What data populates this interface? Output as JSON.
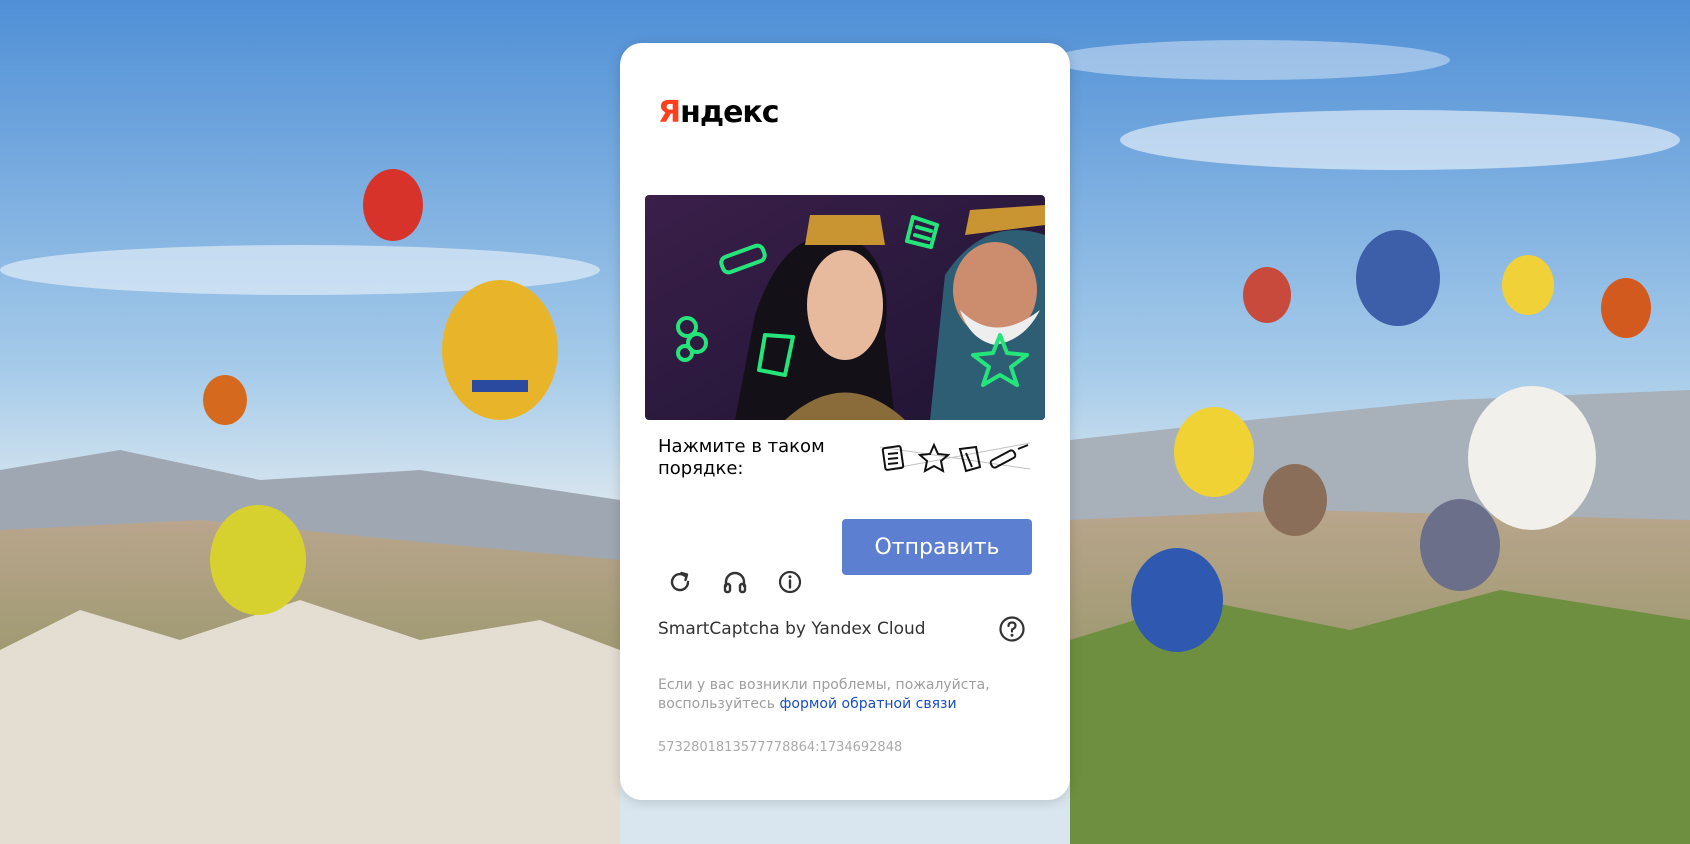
{
  "logo": {
    "first_letter": "Я",
    "rest": "ндекс"
  },
  "captcha": {
    "instruction": "Нажмите в таком порядке:",
    "sequence_icons": [
      "notepad-icon",
      "star-icon",
      "card-icon",
      "pin-icon"
    ]
  },
  "toolbar": {
    "refresh_icon": "refresh-icon",
    "audio_icon": "headphones-icon",
    "info_icon": "info-icon",
    "submit_label": "Отправить"
  },
  "footer": {
    "brand": "SmartCaptcha by Yandex Cloud",
    "help_icon": "question-icon",
    "note_text": "Если у вас возникли проблемы, пожалуйста, воспользуйтесь",
    "note_link": "формой обратной связи",
    "request_id": "5732801813577778864:1734692848"
  },
  "colors": {
    "accent": "#5d7fd1",
    "brand_red": "#fc3f1d",
    "link": "#1a4ec4"
  }
}
